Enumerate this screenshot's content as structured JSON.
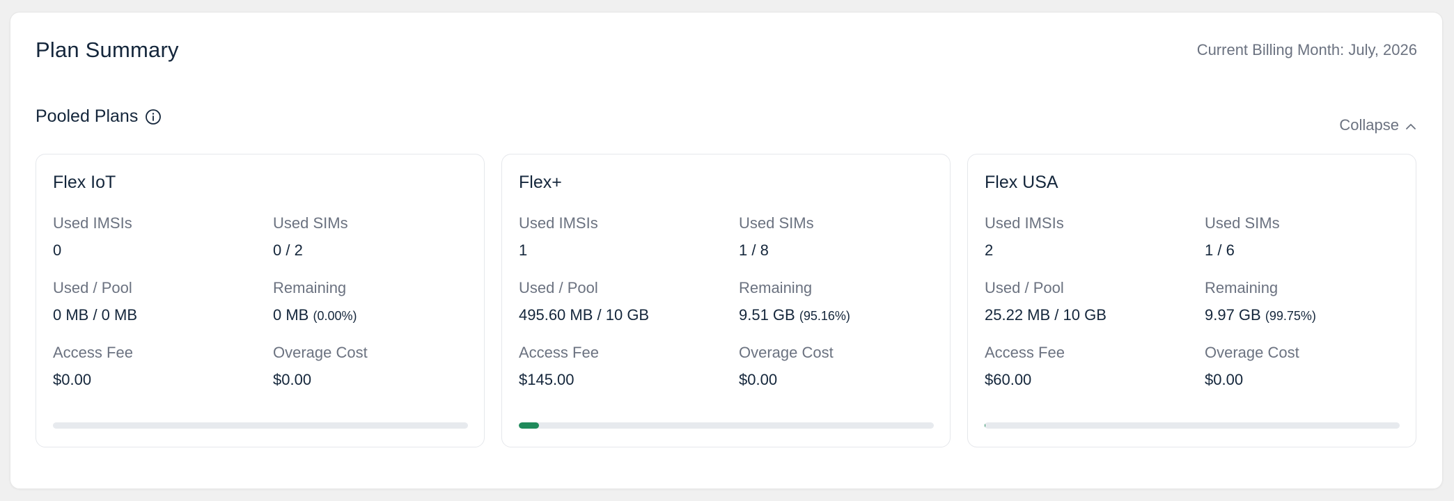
{
  "header": {
    "title": "Plan Summary",
    "billing_month": "Current Billing Month: July, 2026"
  },
  "section": {
    "title": "Pooled Plans",
    "collapse_label": "Collapse"
  },
  "labels": {
    "used_imsis": "Used IMSIs",
    "used_sims": "Used SIMs",
    "used_pool": "Used / Pool",
    "remaining": "Remaining",
    "access_fee": "Access Fee",
    "overage_cost": "Overage Cost"
  },
  "plans": [
    {
      "name": "Flex IoT",
      "used_imsis": "0",
      "used_sims": "0 / 2",
      "used_pool": "0 MB / 0 MB",
      "remaining": "0 MB",
      "remaining_pct": "(0.00%)",
      "access_fee": "$0.00",
      "overage_cost": "$0.00",
      "usage_fraction": 0.0
    },
    {
      "name": "Flex+",
      "used_imsis": "1",
      "used_sims": "1 / 8",
      "used_pool": "495.60 MB / 10 GB",
      "remaining": "9.51 GB",
      "remaining_pct": "(95.16%)",
      "access_fee": "$145.00",
      "overage_cost": "$0.00",
      "usage_fraction": 0.0484
    },
    {
      "name": "Flex USA",
      "used_imsis": "2",
      "used_sims": "1 / 6",
      "used_pool": "25.22 MB / 10 GB",
      "remaining": "9.97 GB",
      "remaining_pct": "(99.75%)",
      "access_fee": "$60.00",
      "overage_cost": "$0.00",
      "usage_fraction": 0.0025
    }
  ],
  "colors": {
    "bar_fill": "#1f8a5b",
    "bar_track": "#e7eaee"
  }
}
